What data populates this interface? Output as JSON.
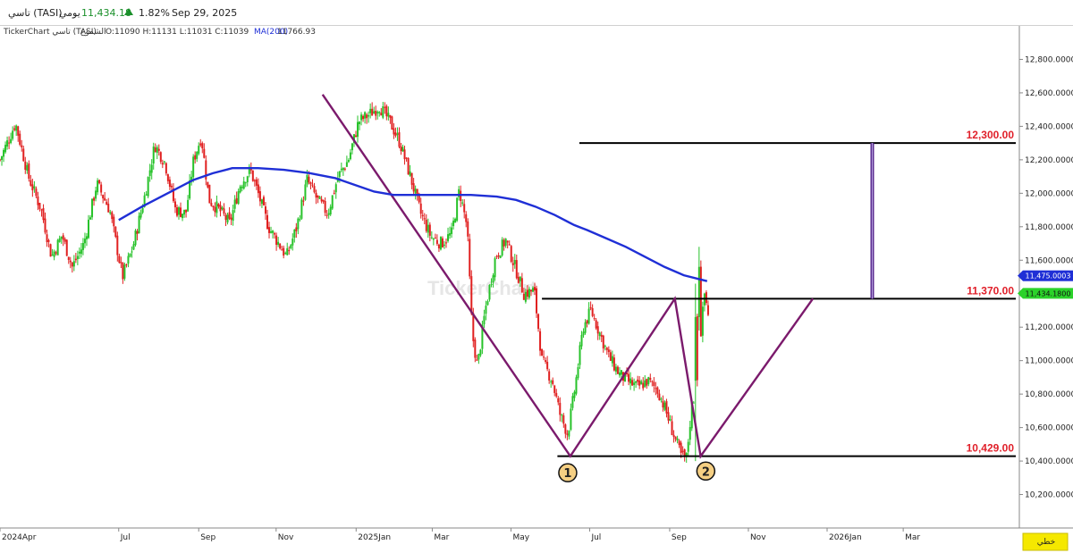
{
  "header": {
    "symbol": "تاسي (TASI)",
    "period": "يومي",
    "last": "11,434.18",
    "change_pct": "1.82%",
    "date": "Sep 29, 2025",
    "up_color": "#1a8f2a"
  },
  "legend": {
    "source": "TickerChart تاسي (TASI)",
    "series_label": "الشموع",
    "ohlc": "O:11090  H:11131  L:11031  C:11039",
    "ma_label": "MA(200)",
    "ma_value": "11766.93"
  },
  "watermark": "TickerChart",
  "footer_button": "خطي",
  "chart_data": {
    "type": "candlestick",
    "y_range": [
      10000,
      13000
    ],
    "y_ticks": [
      10200,
      10400,
      10600,
      10800,
      11000,
      11200,
      11400,
      11600,
      11800,
      12000,
      12200,
      12400,
      12600,
      12800
    ],
    "y_tick_labels": [
      "10,200.0000",
      "10,400.0000",
      "10,600.0000",
      "10,800.0000",
      "11,000.0000",
      "11,200.0000",
      "11,400.0000",
      "11,600.0000",
      "11,800.0000",
      "12,000.0000",
      "12,200.0000",
      "12,400.0000",
      "12,600.0000",
      "12,800.0000"
    ],
    "x_labels": [
      "2024Apr",
      "Jul",
      "Sep",
      "Nov",
      "2025Jan",
      "Mar",
      "May",
      "Jul",
      "Sep",
      "Nov",
      "2026Jan",
      "Mar"
    ],
    "x_label_days": [
      0,
      92,
      154,
      214,
      276,
      335,
      396,
      457,
      519,
      580,
      641,
      700
    ],
    "total_days": 790,
    "up_color": "#27c22a",
    "down_color": "#e02020",
    "close_path": [
      [
        0,
        12200
      ],
      [
        12,
        12420
      ],
      [
        22,
        12100
      ],
      [
        32,
        11900
      ],
      [
        40,
        11620
      ],
      [
        48,
        11750
      ],
      [
        56,
        11560
      ],
      [
        65,
        11700
      ],
      [
        75,
        12060
      ],
      [
        85,
        11900
      ],
      [
        95,
        11500
      ],
      [
        103,
        11680
      ],
      [
        112,
        11980
      ],
      [
        120,
        12290
      ],
      [
        128,
        12180
      ],
      [
        136,
        11900
      ],
      [
        144,
        11880
      ],
      [
        150,
        12200
      ],
      [
        156,
        12340
      ],
      [
        162,
        11960
      ],
      [
        170,
        11900
      ],
      [
        178,
        11820
      ],
      [
        186,
        12050
      ],
      [
        194,
        12140
      ],
      [
        200,
        12000
      ],
      [
        208,
        11800
      ],
      [
        216,
        11700
      ],
      [
        222,
        11620
      ],
      [
        230,
        11800
      ],
      [
        238,
        12080
      ],
      [
        246,
        11960
      ],
      [
        254,
        11880
      ],
      [
        262,
        12100
      ],
      [
        270,
        12200
      ],
      [
        278,
        12430
      ],
      [
        286,
        12470
      ],
      [
        294,
        12520
      ],
      [
        302,
        12430
      ],
      [
        310,
        12300
      ],
      [
        318,
        12100
      ],
      [
        326,
        11880
      ],
      [
        334,
        11740
      ],
      [
        342,
        11700
      ],
      [
        350,
        11760
      ],
      [
        356,
        12020
      ],
      [
        362,
        11800
      ],
      [
        366,
        11160
      ],
      [
        370,
        10960
      ],
      [
        376,
        11300
      ],
      [
        384,
        11620
      ],
      [
        392,
        11720
      ],
      [
        400,
        11540
      ],
      [
        406,
        11400
      ],
      [
        414,
        11420
      ],
      [
        420,
        11000
      ],
      [
        428,
        10880
      ],
      [
        434,
        10680
      ],
      [
        440,
        10560
      ],
      [
        446,
        10860
      ],
      [
        452,
        11200
      ],
      [
        458,
        11300
      ],
      [
        464,
        11180
      ],
      [
        472,
        11020
      ],
      [
        480,
        10920
      ],
      [
        486,
        10880
      ],
      [
        494,
        10840
      ],
      [
        502,
        10880
      ],
      [
        510,
        10820
      ],
      [
        516,
        10700
      ],
      [
        522,
        10560
      ],
      [
        528,
        10430
      ],
      [
        532,
        10420
      ],
      [
        536,
        10720
      ],
      [
        540,
        10860
      ],
      [
        542,
        11080
      ],
      [
        546,
        11400
      ],
      [
        550,
        11240
      ]
    ],
    "special_candles": [
      {
        "day": 352,
        "open": 11940,
        "high": 12090,
        "low": 10620,
        "close": 10730,
        "dir": "down"
      },
      {
        "day": 539,
        "open": 10880,
        "high": 11460,
        "low": 10400,
        "close": 11260,
        "dir": "up"
      },
      {
        "day": 542,
        "open": 11260,
        "high": 11680,
        "low": 11180,
        "close": 11560,
        "dir": "up"
      },
      {
        "day": 544,
        "open": 11520,
        "high": 11650,
        "low": 11300,
        "close": 11360,
        "dir": "down"
      }
    ],
    "ma200": {
      "name": "MA(200)",
      "color": "#1f2fd6",
      "points": [
        [
          92,
          11840
        ],
        [
          110,
          11920
        ],
        [
          130,
          12000
        ],
        [
          150,
          12080
        ],
        [
          165,
          12120
        ],
        [
          180,
          12150
        ],
        [
          200,
          12150
        ],
        [
          220,
          12140
        ],
        [
          240,
          12120
        ],
        [
          260,
          12090
        ],
        [
          275,
          12050
        ],
        [
          290,
          12010
        ],
        [
          305,
          11990
        ],
        [
          325,
          11990
        ],
        [
          345,
          11990
        ],
        [
          365,
          11990
        ],
        [
          385,
          11980
        ],
        [
          400,
          11960
        ],
        [
          415,
          11920
        ],
        [
          430,
          11870
        ],
        [
          445,
          11810
        ],
        [
          455,
          11780
        ],
        [
          470,
          11730
        ],
        [
          485,
          11680
        ],
        [
          500,
          11620
        ],
        [
          515,
          11560
        ],
        [
          530,
          11510
        ],
        [
          548,
          11475
        ]
      ]
    },
    "levels": [
      {
        "value": 12300,
        "label": "12,300.00",
        "x_start": 449
      },
      {
        "value": 11370,
        "label": "11,370.00",
        "x_start": 420
      },
      {
        "value": 10429,
        "label": "10,429.00",
        "x_start": 432
      }
    ],
    "pattern_line": {
      "color": "#7b1a6c",
      "points": [
        [
          250,
          12590
        ],
        [
          442,
          10429
        ],
        [
          523,
          11370
        ],
        [
          543,
          10429
        ],
        [
          630,
          11370
        ]
      ]
    },
    "measure_line": {
      "color": "#5a2b90",
      "day": 676,
      "from": 11370,
      "to": 12300
    },
    "badges": [
      {
        "text": "11,475.0003",
        "value": 11475,
        "bg": "#1f2fd6",
        "fg": "#ffffff"
      },
      {
        "text": "11,434.1800",
        "value": 11434,
        "bg": "#2bd22a",
        "fg": "#111111"
      }
    ],
    "pivot_markers": [
      {
        "label": "1",
        "day": 440,
        "value": 10330
      },
      {
        "label": "2",
        "day": 547,
        "value": 10340
      }
    ]
  }
}
